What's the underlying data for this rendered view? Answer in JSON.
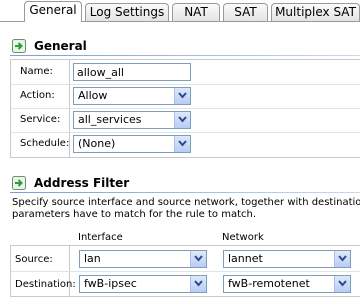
{
  "tabs": [
    {
      "label": "General",
      "active": true
    },
    {
      "label": "Log Settings",
      "active": false
    },
    {
      "label": "NAT",
      "active": false
    },
    {
      "label": "SAT",
      "active": false
    },
    {
      "label": "Multiplex SAT",
      "active": false
    }
  ],
  "general": {
    "title": "General",
    "name_label": "Name:",
    "name_value": "allow_all",
    "action_label": "Action:",
    "action_value": "Allow",
    "service_label": "Service:",
    "service_value": "all_services",
    "schedule_label": "Schedule:",
    "schedule_value": "(None)"
  },
  "address_filter": {
    "title": "Address Filter",
    "description_line1": "Specify source interface and source network, together with destination interface a",
    "description_line2": "parameters have to match for the rule to match.",
    "interface_header": "Interface",
    "network_header": "Network",
    "source_label": "Source:",
    "source_interface": "lan",
    "source_network": "lannet",
    "destination_label": "Destination:",
    "destination_interface": "fwB-ipsec",
    "destination_network": "fwB-remotenet"
  },
  "colors": {
    "accent": "#7a9fd0",
    "icon_green": "#2f9e3a",
    "tab_border": "#9a9a9a"
  },
  "icons": {
    "section_icon": "green-arrow-icon",
    "dropdown": "chevron-down-icon"
  }
}
